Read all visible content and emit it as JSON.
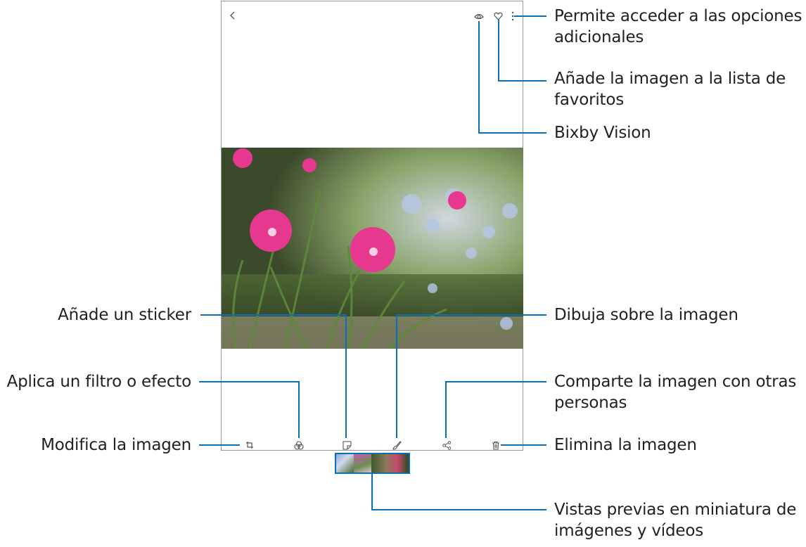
{
  "callouts": {
    "more_options": [
      "Permite acceder a las opciones",
      "adicionales"
    ],
    "favorite": [
      "Añade la imagen a la lista de",
      "favoritos"
    ],
    "bixby_vision": "Bixby Vision",
    "sticker": "Añade un sticker",
    "draw": "Dibuja sobre la imagen",
    "filter": "Aplica un filtro o efecto",
    "share": [
      "Comparte la imagen con otras",
      "personas"
    ],
    "edit": "Modifica la imagen",
    "delete": "Elimina la imagen",
    "thumbnails": [
      "Vistas previas en miniatura de",
      "imágenes y vídeos"
    ]
  },
  "icons": {
    "back": "chevron-left-icon",
    "bixby": "eye-icon",
    "favorite": "heart-icon",
    "more": "more-vertical-icon",
    "edit": "crop-rotate-icon",
    "filter": "filter-circles-icon",
    "sticker": "sticker-icon",
    "draw": "brush-icon",
    "share": "share-icon",
    "delete": "trash-icon"
  },
  "colors": {
    "callout_line": "#0a6fb5",
    "text": "#231f20",
    "device_border": "#9a9a9a",
    "icon": "#555555"
  }
}
